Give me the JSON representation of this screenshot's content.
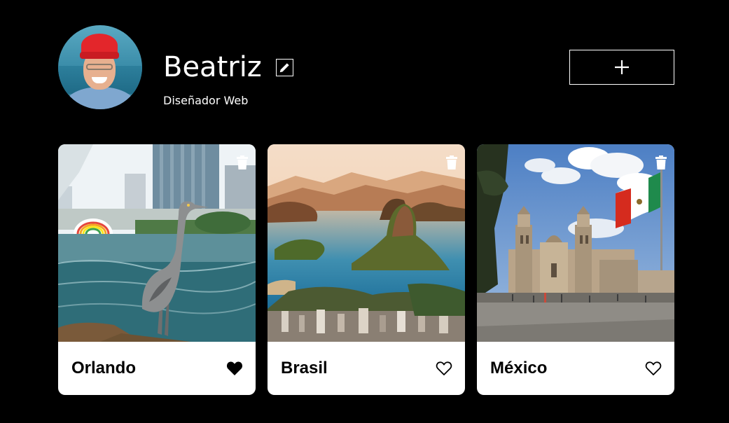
{
  "profile": {
    "name": "Beatriz",
    "job": "Diseñador Web",
    "avatar_icon": "avatar-photo",
    "edit_icon": "pencil-icon"
  },
  "add_button": {
    "icon": "plus-icon"
  },
  "cards": [
    {
      "title": "Orlando",
      "liked": true,
      "photo": "heron-by-lake-with-city-skyline",
      "delete_icon": "trash-icon",
      "like_icon": "heart-filled-icon"
    },
    {
      "title": "Brasil",
      "liked": false,
      "photo": "rio-de-janeiro-bay-aerial",
      "delete_icon": "trash-icon",
      "like_icon": "heart-outline-icon"
    },
    {
      "title": "México",
      "liked": false,
      "photo": "mexico-city-cathedral-with-flag",
      "delete_icon": "trash-icon",
      "like_icon": "heart-outline-icon"
    }
  ],
  "colors": {
    "background": "#000000",
    "card": "#ffffff",
    "text_light": "#ffffff",
    "text_dark": "#000000"
  }
}
